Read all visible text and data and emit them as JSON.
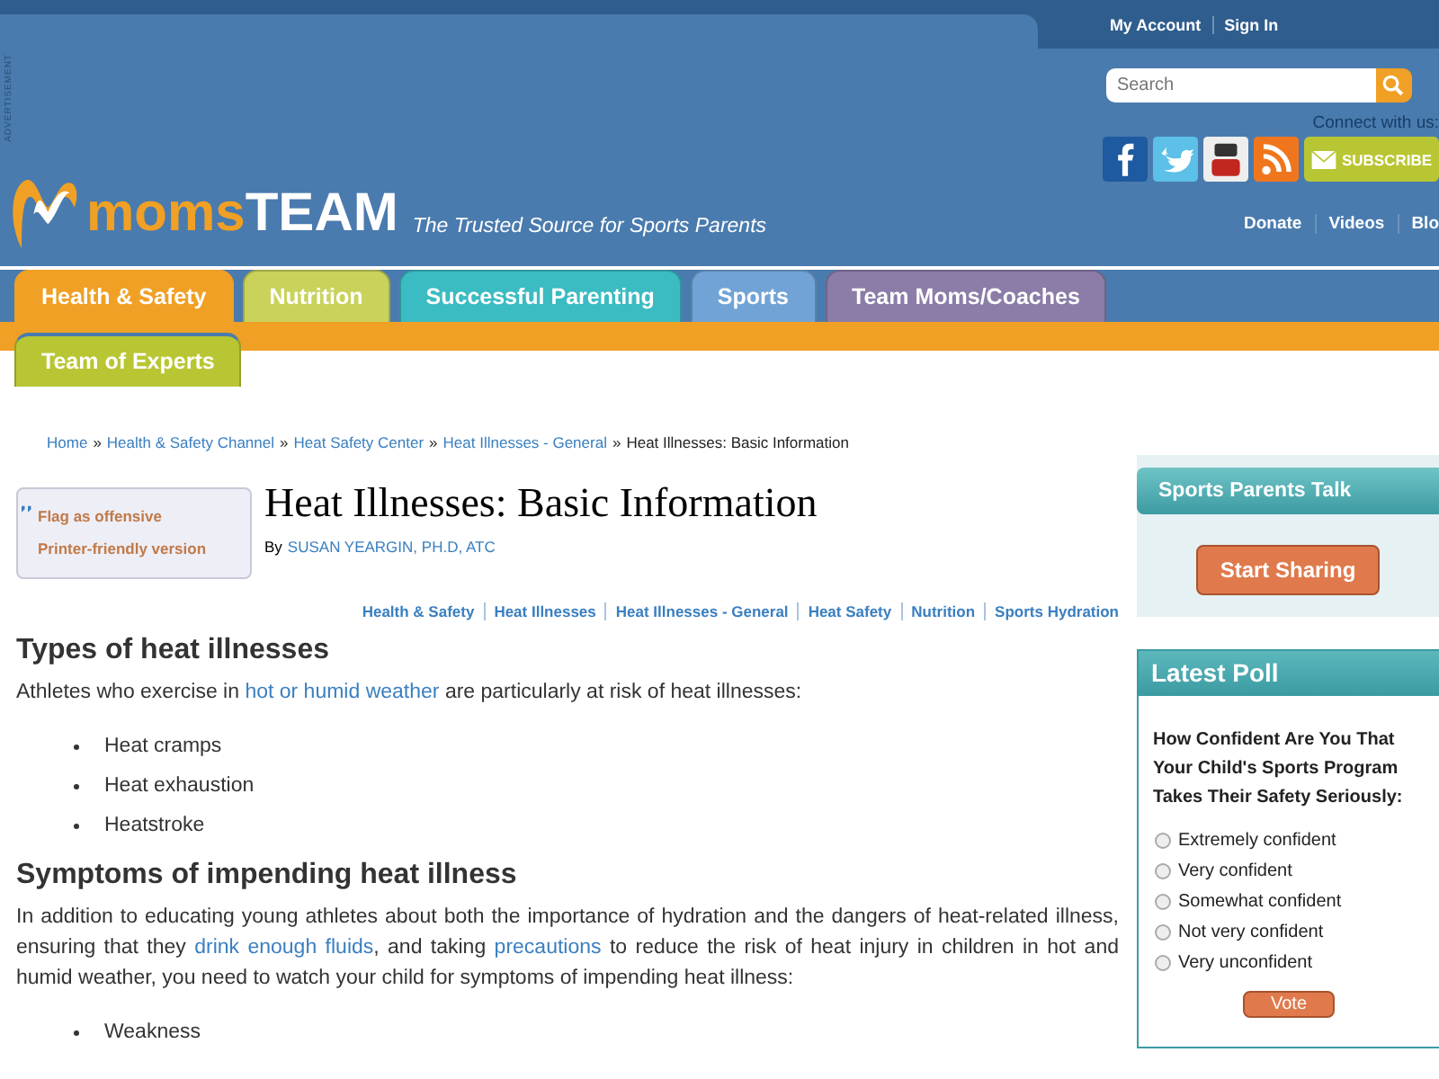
{
  "header": {
    "ad_label": "ADVERTISEMENT",
    "logo": {
      "moms": "moms",
      "team": "TEAM"
    },
    "tagline": "The Trusted Source for Sports Parents",
    "account_links": [
      "My Account",
      "Sign In"
    ],
    "search": {
      "placeholder": "Search"
    },
    "connect_label": "Connect with us:",
    "subscribe": "SUBSCRIBE",
    "nav_links": [
      "Donate",
      "Videos",
      "Blo"
    ]
  },
  "tabs": [
    {
      "label": "Health & Safety",
      "color": "#f0a024",
      "selected": true
    },
    {
      "label": "Nutrition",
      "color": "#c9d35c",
      "selected": false
    },
    {
      "label": "Successful Parenting",
      "color": "#3bbbc2",
      "selected": false
    },
    {
      "label": "Sports",
      "color": "#72a3d6",
      "selected": false
    },
    {
      "label": "Team Moms/Coaches",
      "color": "#8b7ca8",
      "selected": false
    }
  ],
  "subtabs": [
    {
      "label": "Team of Experts",
      "color": "#b9c633",
      "selected": false
    }
  ],
  "breadcrumb": {
    "separator": "»",
    "links": [
      "Home",
      "Health & Safety Channel",
      "Heat Safety Center",
      "Heat Illnesses - General"
    ],
    "current": "Heat Illnesses: Basic Information"
  },
  "tools": [
    "Flag as offensive",
    "Printer-friendly version"
  ],
  "article": {
    "title": "Heat Illnesses: Basic Information",
    "by": "By",
    "author": "SUSAN YEARGIN, PH.D, ATC",
    "tags": [
      "Health & Safety",
      "Heat Illnesses",
      "Heat Illnesses - General",
      "Heat Safety",
      "Nutrition",
      "Sports Hydration"
    ],
    "sections": [
      {
        "heading": "Types of heat illnesses",
        "paragraph": [
          {
            "text": "Athletes who exercise in ",
            "link": false
          },
          {
            "text": "hot or humid weather",
            "link": true
          },
          {
            "text": " are particularly at risk of heat illnesses:",
            "link": false
          }
        ],
        "bullets": [
          "Heat cramps",
          "Heat exhaustion",
          "Heatstroke"
        ]
      },
      {
        "heading": "Symptoms of impending heat illness",
        "paragraph": [
          {
            "text": "In addition to educating young athletes about both the importance of hydration and the dangers of heat-related illness, ensuring that they ",
            "link": false
          },
          {
            "text": "drink enough fluids",
            "link": true
          },
          {
            "text": ", and taking ",
            "link": false
          },
          {
            "text": "precautions",
            "link": true
          },
          {
            "text": " to reduce the risk of heat injury in children in hot and humid weather, you need to watch your child for symptoms of impending heat illness:",
            "link": false
          }
        ],
        "bullets": [
          "Weakness"
        ]
      }
    ]
  },
  "sidebar": {
    "talk": {
      "title": "Sports Parents Talk",
      "button": "Start Sharing"
    },
    "poll": {
      "title": "Latest Poll",
      "question": "How Confident Are You That Your Child's Sports Program Takes Their Safety Seriously:",
      "options": [
        {
          "label": "Extremely confident",
          "selected": false
        },
        {
          "label": "Very confident",
          "selected": false
        },
        {
          "label": "Somewhat confident",
          "selected": false
        },
        {
          "label": "Not very confident",
          "selected": false
        },
        {
          "label": "Very unconfident",
          "selected": false
        }
      ],
      "button": "Vote"
    }
  }
}
